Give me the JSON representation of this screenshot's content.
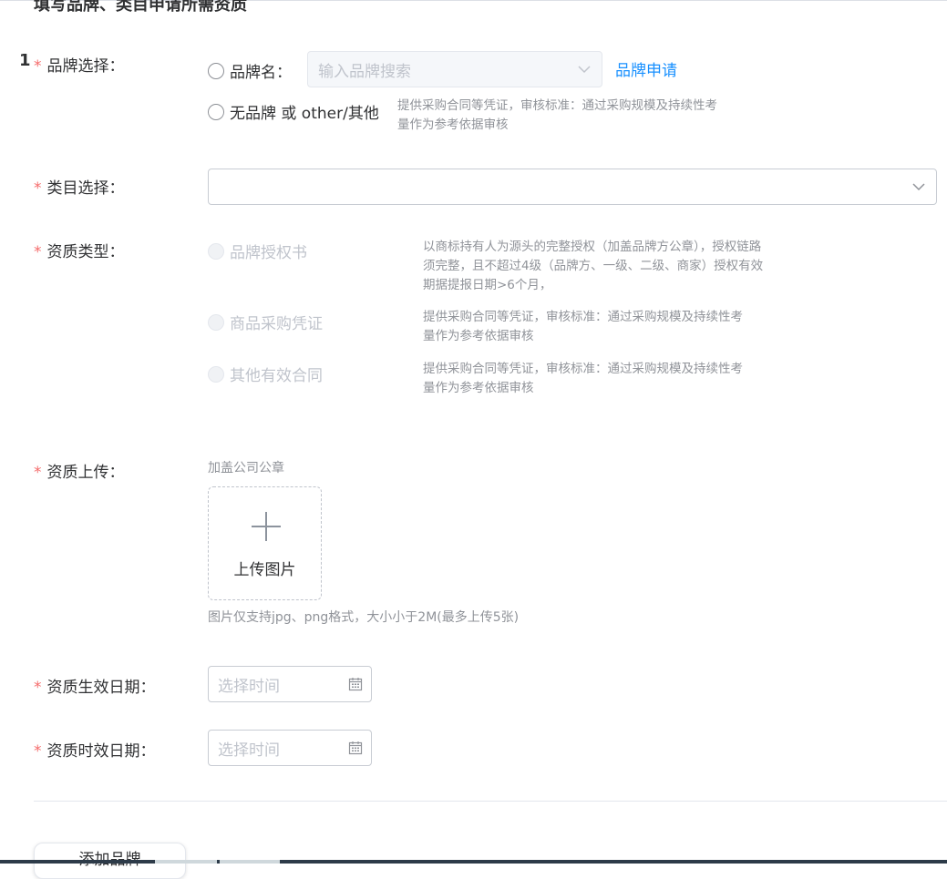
{
  "section_title": "填写品牌、类目申请所需资质",
  "row_index": "1",
  "required_mark": "*",
  "brand": {
    "label": "品牌选择：",
    "option_brand_name": "品牌名：",
    "search_placeholder": "输入品牌搜索",
    "apply_link": "品牌申请",
    "option_no_brand": "无品牌 或 other/其他",
    "no_brand_hint": "提供采购合同等凭证，审核标准：通过采购规模及持续性考量作为参考依据审核"
  },
  "category": {
    "label": "类目选择：",
    "value": ""
  },
  "qualification_type": {
    "label": "资质类型：",
    "options": [
      {
        "label": "品牌授权书",
        "hint": "以商标持有人为源头的完整授权（加盖品牌方公章），授权链路须完整，且不超过4级（品牌方、一级、二级、商家）授权有效期据提报日期>6个月，",
        "disabled": true
      },
      {
        "label": "商品采购凭证",
        "hint": "提供采购合同等凭证，审核标准：通过采购规模及持续性考量作为参考依据审核",
        "disabled": true
      },
      {
        "label": "其他有效合同",
        "hint": "提供采购合同等凭证，审核标准：通过采购规模及持续性考量作为参考依据审核",
        "disabled": true
      }
    ]
  },
  "upload": {
    "label": "资质上传：",
    "stamp_hint": "加盖公司公章",
    "button_text": "上传图片",
    "format_tip": "图片仅支持jpg、png格式，大小小于2M(最多上传5张)"
  },
  "effective_date": {
    "label": "资质生效日期：",
    "placeholder": "选择时间"
  },
  "expiry_date": {
    "label": "资质时效日期：",
    "placeholder": "选择时间"
  },
  "add_brand_button": "添加品牌",
  "colors": {
    "required": "#f56c6c",
    "link": "#1890ff",
    "hint": "#909399",
    "disabled": "#c0c4cc"
  },
  "icons": [
    "chevron-down-icon",
    "plus-icon",
    "calendar-icon"
  ]
}
